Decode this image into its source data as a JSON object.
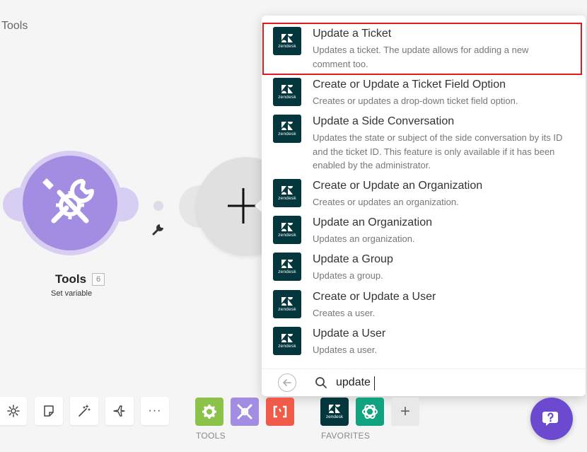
{
  "breadcrumb": "Tools",
  "module": {
    "name": "Tools",
    "badge": "6",
    "subtitle": "Set variable",
    "color": "#a38de3"
  },
  "dropdown": {
    "items": [
      {
        "title": "Update a Ticket",
        "description": "Updates a ticket. The update allows for adding a new comment too.",
        "highlighted": true
      },
      {
        "title": "Create or Update a Ticket Field Option",
        "description": "Creates or updates a drop-down ticket field option."
      },
      {
        "title": "Update a Side Conversation",
        "description": "Updates the state or subject of the side conversation by its ID and the ticket ID. This feature is only available if it has been enabled by the administrator."
      },
      {
        "title": "Create or Update an Organization",
        "description": "Creates or updates an organization."
      },
      {
        "title": "Update an Organization",
        "description": "Updates an organization."
      },
      {
        "title": "Update a Group",
        "description": "Updates a group."
      },
      {
        "title": "Create or Update a User",
        "description": "Creates a user."
      },
      {
        "title": "Update a User",
        "description": "Updates a user."
      }
    ],
    "logo_icon": "zendesk-logo",
    "logo_text": "zendesk",
    "search_value": "update"
  },
  "toolbar": {
    "buttons": [
      "settings-icon",
      "note-icon",
      "magic-wand-icon",
      "airplane-icon",
      "more-icon"
    ],
    "more_label": "···",
    "tools_label": "TOOLS",
    "favorites_label": "FAVORITES",
    "add_label": "+",
    "colors": {
      "tools_green": "#8bc34a",
      "tools_purple": "#a38de3",
      "tools_red": "#f05a48",
      "zendesk": "#03363d",
      "openai": "#10a37f",
      "help": "#6c4ad0",
      "highlight": "#e01b1b"
    }
  }
}
